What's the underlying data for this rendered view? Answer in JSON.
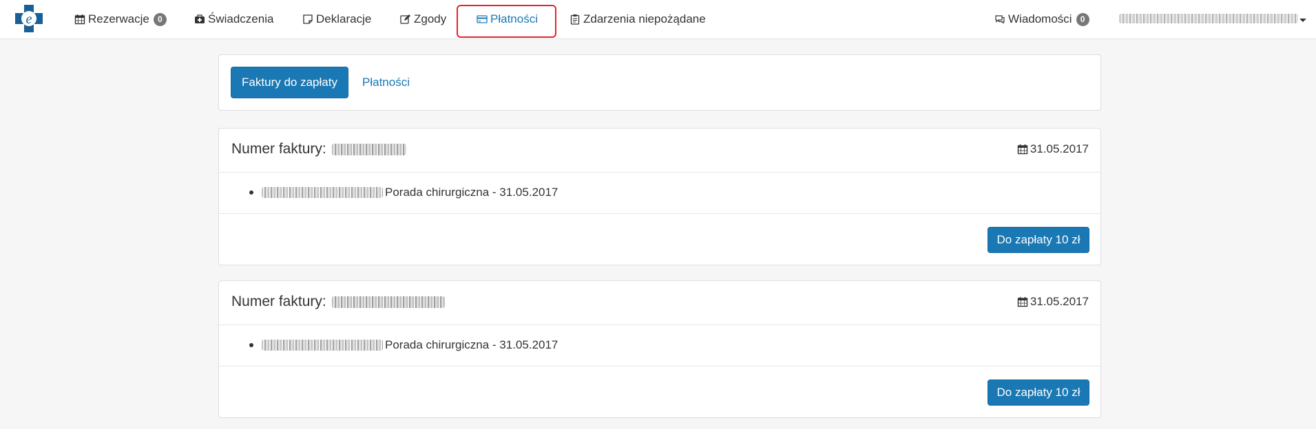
{
  "navbar": {
    "items": [
      {
        "label": "Rezerwacje",
        "badge": "0",
        "icon": "calendar-icon"
      },
      {
        "label": "Świadczenia",
        "icon": "medkit-icon"
      },
      {
        "label": "Deklaracje",
        "icon": "sticky-note-icon"
      },
      {
        "label": "Zgody",
        "icon": "edit-icon"
      },
      {
        "label": "Płatności",
        "icon": "credit-card-icon",
        "active": true
      },
      {
        "label": "Zdarzenia niepożądane",
        "icon": "clipboard-icon"
      }
    ],
    "messages": {
      "label": "Wiadomości",
      "badge": "0",
      "icon": "comments-icon"
    }
  },
  "tabs": {
    "invoices_to_pay": "Faktury do zapłaty",
    "payments": "Płatności"
  },
  "invoices": [
    {
      "title_label": "Numer faktury:",
      "date": "31.05.2017",
      "item_text": "Porada chirurgiczna - 31.05.2017",
      "pay_label": "Do zapłaty 10 zł"
    },
    {
      "title_label": "Numer faktury:",
      "date": "31.05.2017",
      "item_text": "Porada chirurgiczna - 31.05.2017",
      "pay_label": "Do zapłaty 10 zł"
    }
  ],
  "colors": {
    "accent": "#1a78b4",
    "highlight": "#e8202a",
    "badge": "#777777"
  }
}
